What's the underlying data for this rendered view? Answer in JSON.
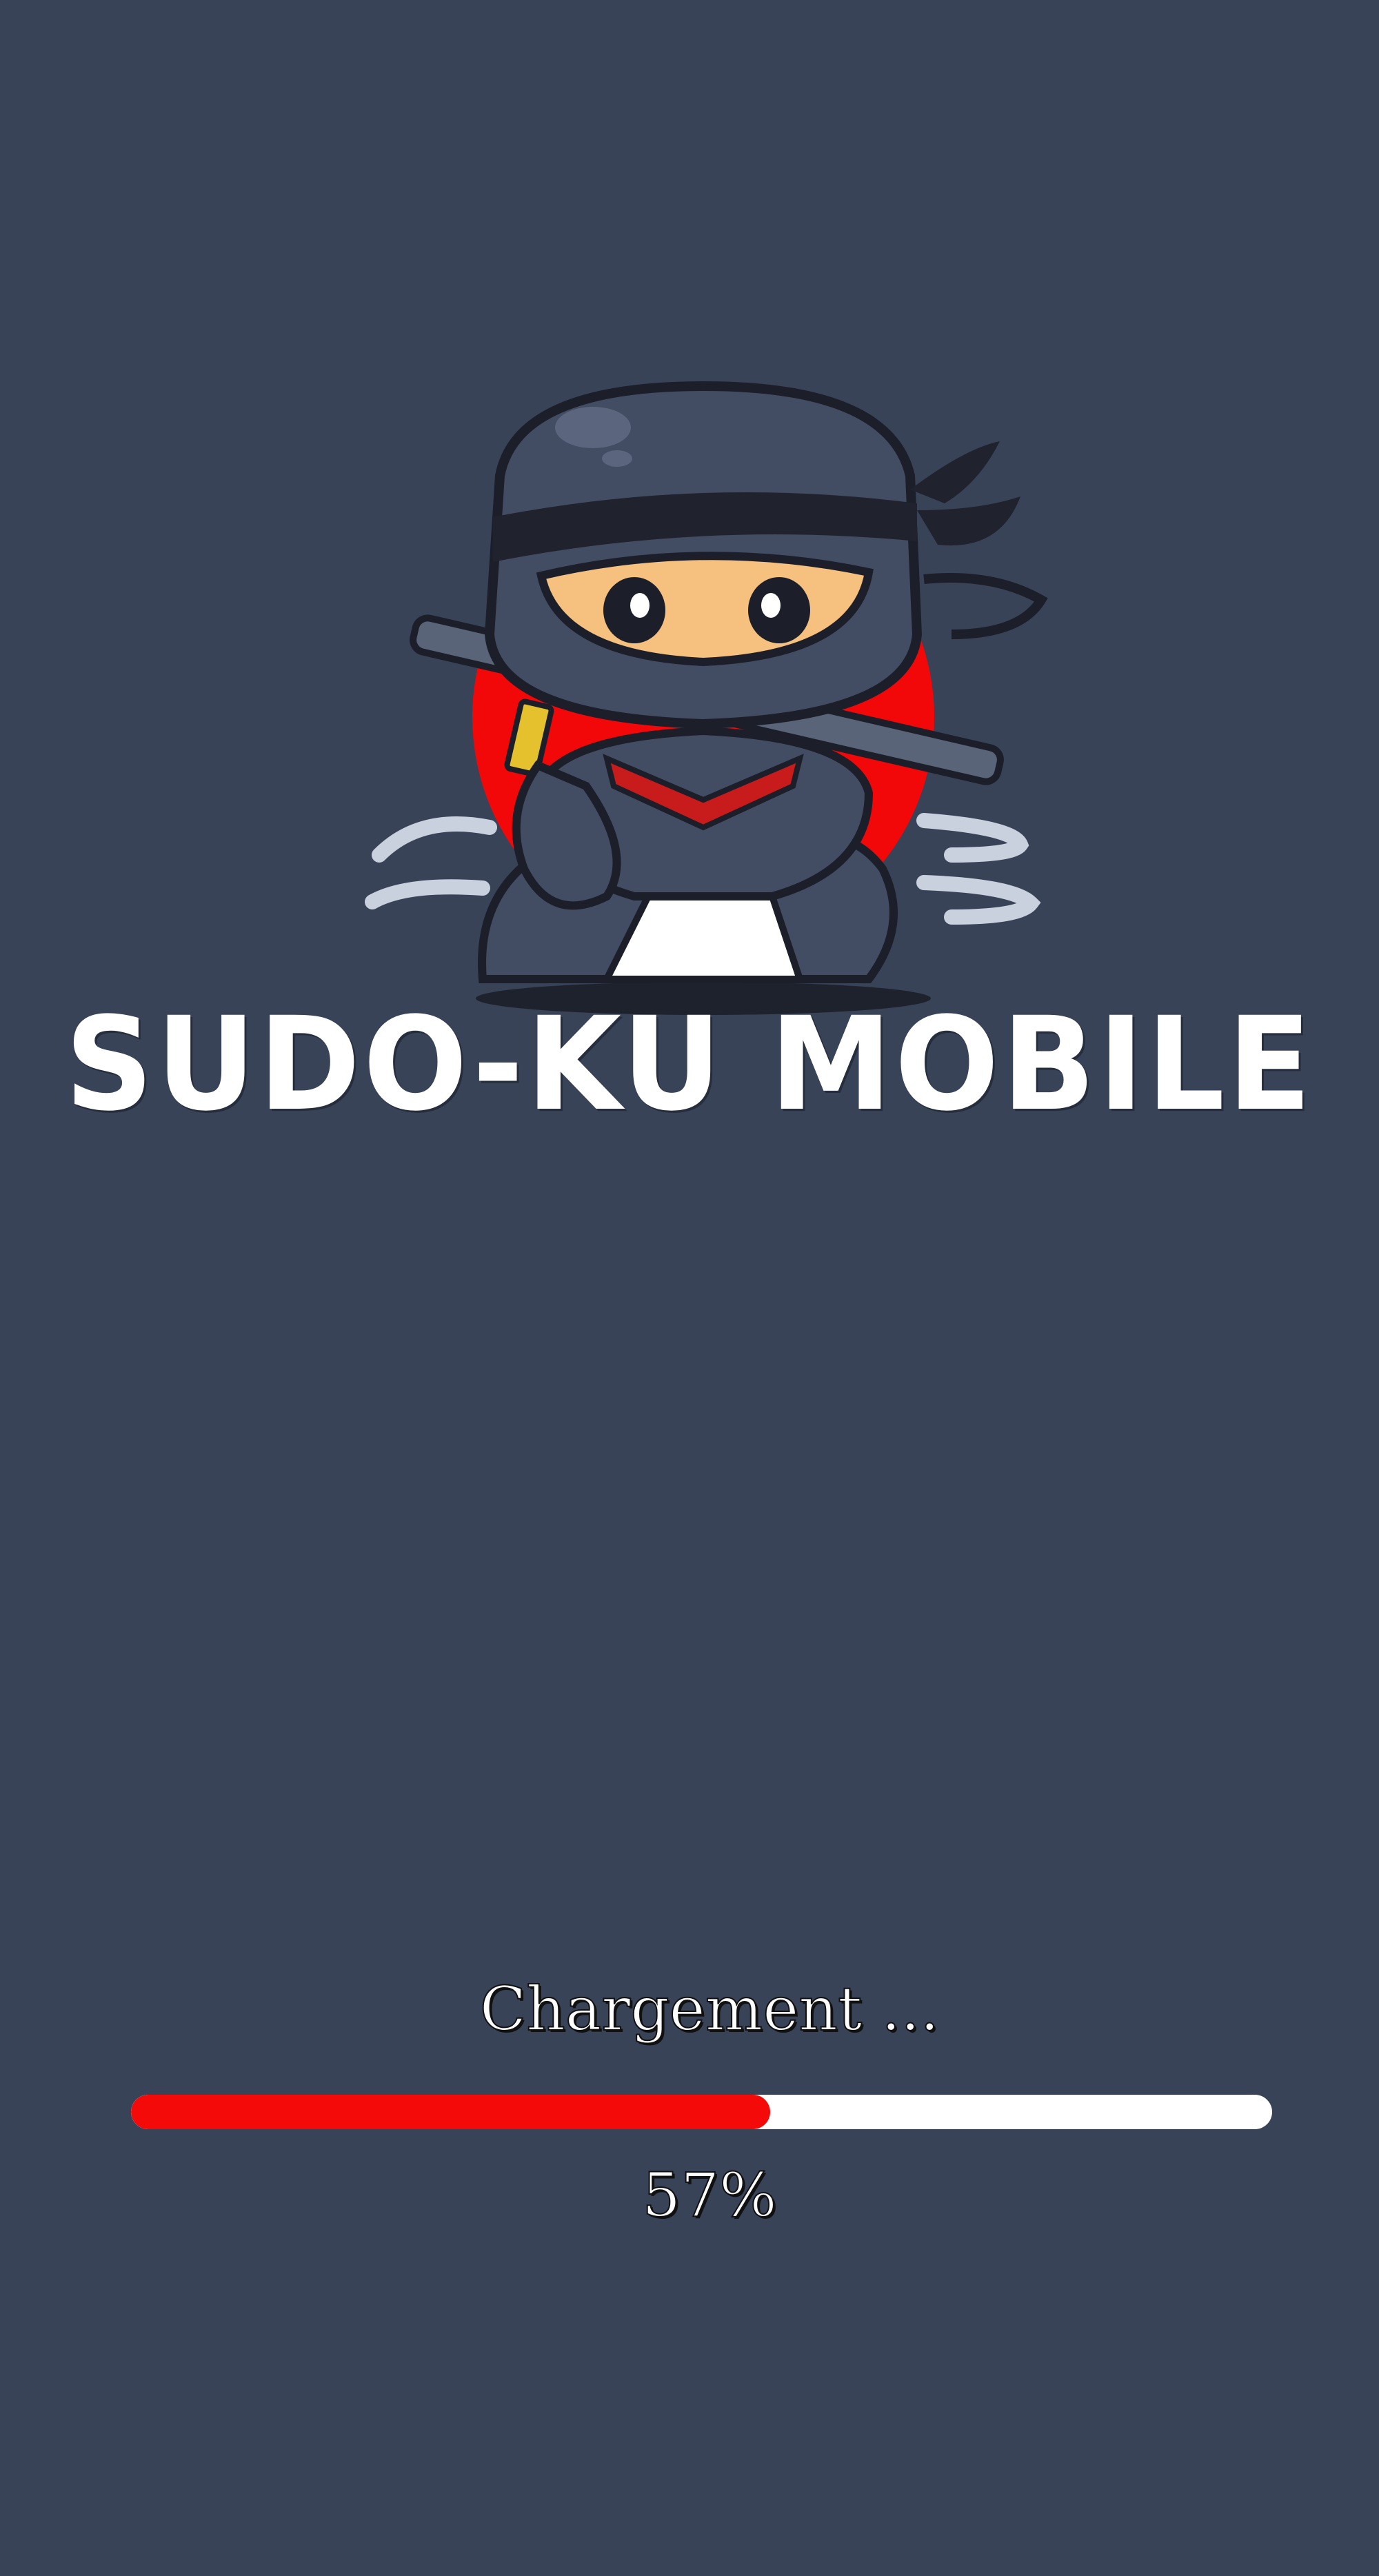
{
  "app": {
    "title": "SUDO-KU MOBILE"
  },
  "loading": {
    "label": "Chargement ...",
    "progress_fraction": 0.56,
    "percent_text": "57%"
  },
  "logo": {
    "icon": "ninja-mascot-icon",
    "sun_icon": "red-sun-icon"
  },
  "colors": {
    "background": "#384357",
    "accent": "#f50a0a",
    "track": "#ffffff",
    "text": "#ffffff"
  }
}
